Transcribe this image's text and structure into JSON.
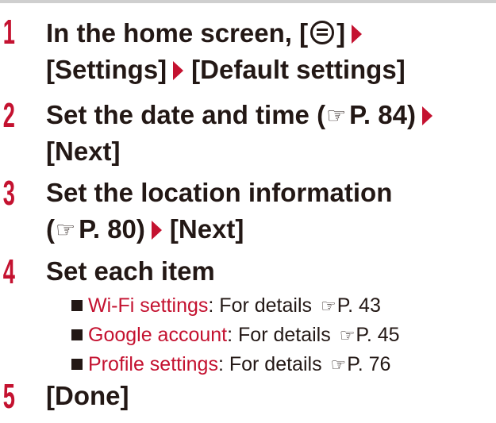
{
  "steps": [
    {
      "number": "1",
      "line1_text": "In the home screen, [",
      "line1_after_icon": "]",
      "line2_a": "[Settings]",
      "line2_b": "[Default settings]"
    },
    {
      "number": "2",
      "line1_text": "Set the date and time (",
      "line1_ref": "P. 84)",
      "line2": "[Next]"
    },
    {
      "number": "3",
      "line1": "Set the location information",
      "line2_open": "(",
      "line2_ref": "P. 80)",
      "line2_next": "[Next]"
    },
    {
      "number": "4",
      "line1": "Set each item",
      "items": [
        {
          "link": "Wi-Fi settings",
          "text": ": For details ",
          "ref": "P. 43"
        },
        {
          "link": "Google account",
          "text": ": For details ",
          "ref": "P. 45"
        },
        {
          "link": "Profile settings",
          "text": ": For details ",
          "ref": "P. 76"
        }
      ]
    },
    {
      "number": "5",
      "line1": "[Done]"
    }
  ],
  "icons": {
    "menu_key": "menu-key-icon",
    "reference": "reference-hand-icon",
    "arrow": "red-arrow-icon",
    "bullet": "square-bullet-icon"
  },
  "colors": {
    "accent": "#c41230",
    "text": "#231815"
  }
}
